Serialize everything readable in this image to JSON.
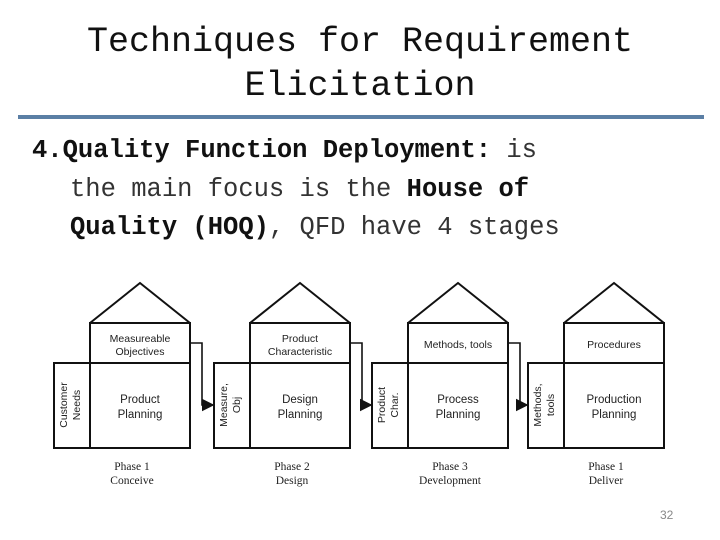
{
  "slide": {
    "title_line1": "Techniques for Requirement",
    "title_line2": "Elicitation",
    "body": {
      "line1": {
        "bold": "4.Quality Function Deployment:",
        "normal": " is"
      },
      "line2": {
        "normal": "the main focus is the ",
        "bold": "House of"
      },
      "line3": {
        "bold": "Quality (HOQ)",
        "normal": ", QFD have 4 stages"
      }
    },
    "page_number": "32"
  },
  "diagram": {
    "houses": [
      {
        "roof_label_1": "Measureable",
        "roof_label_2": "Objectives",
        "side_label_1": "Customer",
        "side_label_2": "Needs",
        "main_label_1": "Product",
        "main_label_2": "Planning",
        "phase": "Phase 1",
        "phase_name": "Conceive"
      },
      {
        "roof_label_1": "Product",
        "roof_label_2": "Characteristic",
        "side_label_1": "Measure,",
        "side_label_2": "Obj",
        "main_label_1": "Design",
        "main_label_2": "Planning",
        "phase": "Phase 2",
        "phase_name": "Design"
      },
      {
        "roof_label_1": "Methods, tools",
        "roof_label_2": "",
        "side_label_1": "Product",
        "side_label_2": "Char.",
        "main_label_1": "Process",
        "main_label_2": "Planning",
        "phase": "Phase 3",
        "phase_name": "Development"
      },
      {
        "roof_label_1": "Procedures",
        "roof_label_2": "",
        "side_label_1": "Methods,",
        "side_label_2": "tools",
        "main_label_1": "Production",
        "main_label_2": "Planning",
        "phase": "Phase 1",
        "phase_name": "Deliver"
      }
    ]
  }
}
